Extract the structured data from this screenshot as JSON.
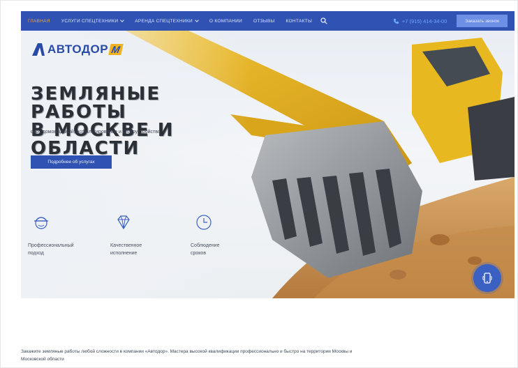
{
  "nav": {
    "items": [
      {
        "label": "Главная",
        "active": true,
        "dropdown": false
      },
      {
        "label": "Услуги спецтехники",
        "active": false,
        "dropdown": true
      },
      {
        "label": "Аренда спецтехники",
        "active": false,
        "dropdown": true
      },
      {
        "label": "О компании",
        "active": false,
        "dropdown": false
      },
      {
        "label": "Отзывы",
        "active": false,
        "dropdown": false
      },
      {
        "label": "Контакты",
        "active": false,
        "dropdown": false
      }
    ],
    "search_icon": "search-icon",
    "phone": "+7 (915) 414-34-00",
    "callback_label": "Заказать звонок"
  },
  "logo": {
    "text": "АВТОДОР",
    "suffix": "М"
  },
  "hero": {
    "headline_line1": "Земляные работы",
    "headline_line2": "в Москве и области",
    "subtitle": "снос домов/зданий, асфальтирование и благоустройство",
    "cta_label": "Подробнее об услугах"
  },
  "features": [
    {
      "icon": "worker-helmet-icon",
      "line1": "Профессиональный",
      "line2": "подход"
    },
    {
      "icon": "diamond-icon",
      "line1": "Качественное",
      "line2": "исполнение"
    },
    {
      "icon": "clock-icon",
      "line1": "Соблюдение",
      "line2": "сроков"
    }
  ],
  "floating_button": {
    "icon": "phone-call-icon"
  },
  "intro": {
    "line1": "Закажите земляные работы любой сложности в компании «Автодор». Мастера высокой квалификации профессионально и быстро на территории Москвы и",
    "line2": "Московской области"
  },
  "colors": {
    "nav_bg": "#2f52b3",
    "accent_orange": "#f0a43a",
    "logo_yellow": "#f0b21e",
    "button_blue": "#2f52b3"
  }
}
